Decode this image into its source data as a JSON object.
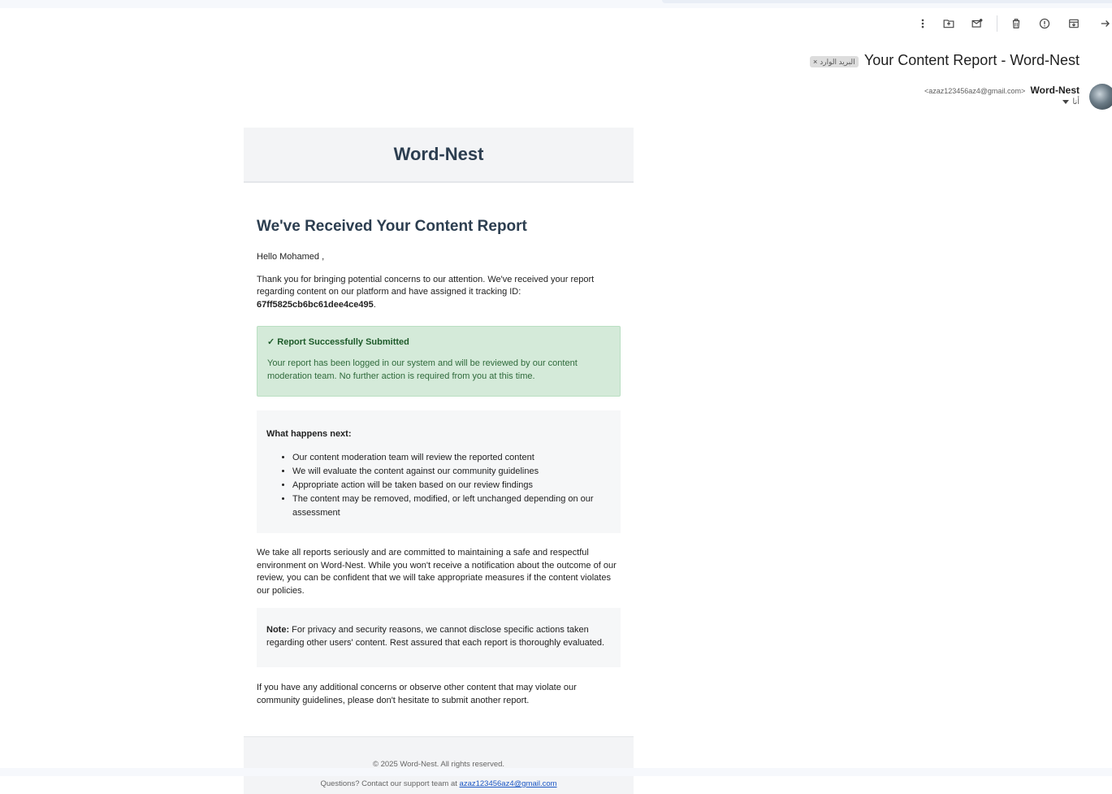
{
  "header": {
    "subject": "Your Content Report - Word-Nest",
    "label": "البريد الوارد",
    "label_remove": "×",
    "sender_name": "Word-Nest",
    "sender_email": "<azaz123456az4@gmail.com>",
    "recipient": "أنا"
  },
  "toolbar": {
    "icons": [
      "more-vert-icon",
      "move-to-folder-icon",
      "mark-unread-icon",
      "delete-icon",
      "report-spam-icon",
      "archive-icon",
      "back-arrow-icon"
    ]
  },
  "email": {
    "brand": "Word-Nest",
    "heading": "We've Received Your Content Report",
    "greeting": "Hello Mohamed ,",
    "intro_text": "Thank you for bringing potential concerns to our attention. We've received your report regarding content on our platform and have assigned it tracking ID: ",
    "tracking_id": "67ff5825cb6bc61dee4ce495",
    "intro_end": ".",
    "success_title": "✓ Report Successfully Submitted",
    "success_body": "Your report has been logged in our system and will be reviewed by our content moderation team. No further action is required from you at this time.",
    "next_title": "What happens next:",
    "next_items": [
      "Our content moderation team will review the reported content",
      "We will evaluate the content against our community guidelines",
      "Appropriate action will be taken based on our review findings",
      "The content may be removed, modified, or left unchanged depending on our assessment"
    ],
    "closing": "We take all reports seriously and are committed to maintaining a safe and respectful environment on Word-Nest. While you won't receive a notification about the outcome of our review, you can be confident that we will take appropriate measures if the content violates our policies.",
    "note_label": "Note:",
    "note_text": " For privacy and security reasons, we cannot disclose specific actions taken regarding other users' content. Rest assured that each report is thoroughly evaluated.",
    "final": "If you have any additional concerns or observe other content that may violate our community guidelines, please don't hesitate to submit another report.",
    "footer_copyright": "© 2025 Word-Nest. All rights reserved.",
    "footer_question": "Questions? Contact our support team at ",
    "footer_email": "azaz123456az4@gmail.com"
  }
}
